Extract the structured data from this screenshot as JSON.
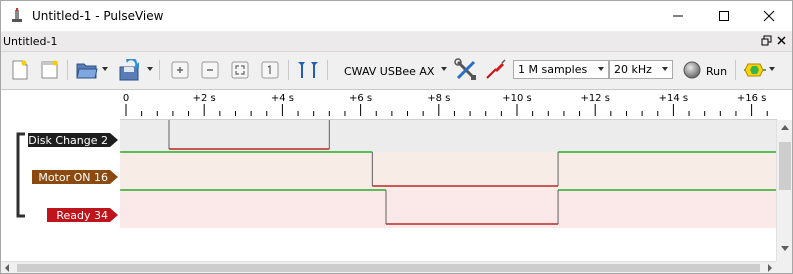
{
  "window": {
    "title": "Untitled-1 - PulseView"
  },
  "dock": {
    "title": "Untitled-1"
  },
  "toolbar": {
    "device": "CWAV USBee AX",
    "samples": "1 M samples",
    "rate": "20 kHz",
    "run_label": "Run"
  },
  "ruler": {
    "ticks": [
      "0",
      "+2 s",
      "+4 s",
      "+6 s",
      "+8 s",
      "+10 s",
      "+12 s",
      "+14 s",
      "+16 s"
    ]
  },
  "channels": [
    {
      "name": "Disk Change 2",
      "color": "#1e1e1e",
      "band": "#ececec",
      "transitions": [
        {
          "t": 1.1,
          "level": 0
        },
        {
          "t": 5.2,
          "level": 1
        }
      ],
      "initial": 1
    },
    {
      "name": "Motor ON 16",
      "color": "#8a4a10",
      "band": "#f7ece6",
      "transitions": [
        {
          "t": 6.3,
          "level": 0
        },
        {
          "t": 11.05,
          "level": 1
        }
      ],
      "initial": 1
    },
    {
      "name": "Ready 34",
      "color": "#c0141c",
      "band": "#fbe8e8",
      "transitions": [
        {
          "t": 6.65,
          "level": 0
        },
        {
          "t": 11.05,
          "level": 1
        }
      ],
      "initial": 1
    }
  ],
  "colors": {
    "high": "#00a000",
    "low": "#b00000"
  },
  "icons": {
    "new": "new-session-icon",
    "open": "open-file-icon",
    "save": "save-icon",
    "zoom_in": "zoom-in-icon",
    "zoom_out": "zoom-out-icon",
    "zoom_fit": "zoom-fit-icon",
    "zoom_one": "zoom-one-icon",
    "cursor": "cursor-icon",
    "config": "tools-icon",
    "probe": "probe-icon",
    "run": "run-icon",
    "decoder": "decoder-icon"
  }
}
